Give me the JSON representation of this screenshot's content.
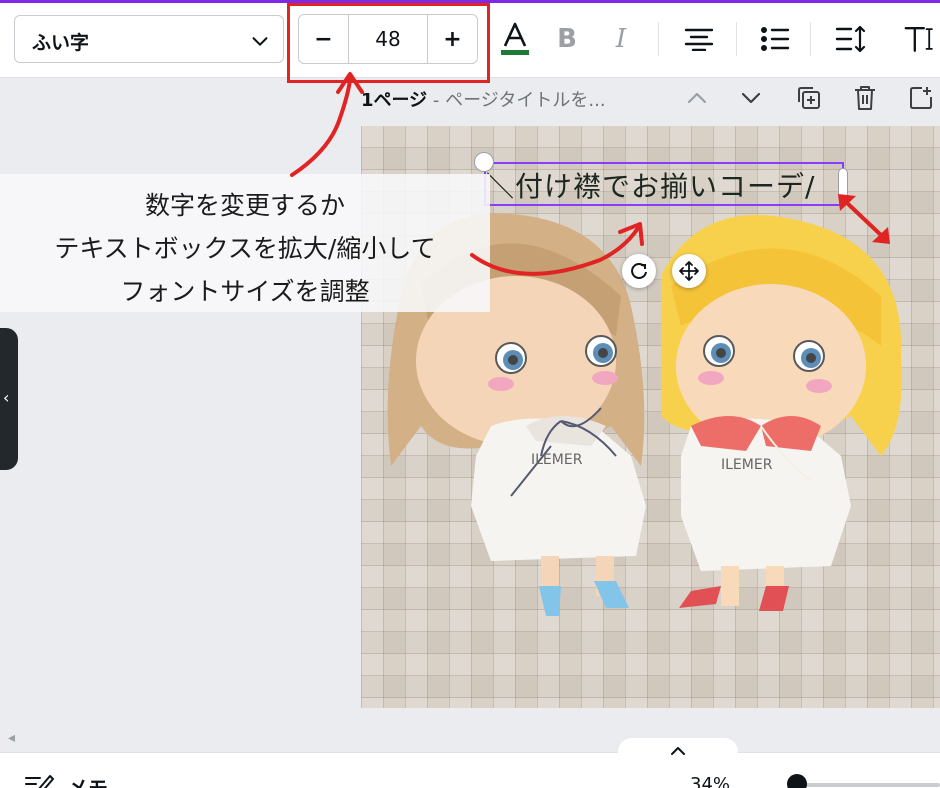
{
  "toolbar": {
    "font_name": "ふい字",
    "font_size": "48",
    "minus_label": "−",
    "plus_label": "+",
    "accent_underline_color": "#1f7a3a",
    "highlight_color": "#e02424"
  },
  "page_header": {
    "page_number": "1ページ",
    "separator": " - ",
    "title_placeholder": "ページタイトルを..."
  },
  "canvas": {
    "text_content": "＼付け襟でお揃いコーデ/",
    "selection_color": "#8b3dff",
    "doll_left_shirt": "ILEMER",
    "doll_right_shirt": "ILEMER"
  },
  "annotation": {
    "line1": "数字を変更するか",
    "line2": "テキストボックスを拡大/縮小して",
    "line3": "フォントサイズを調整",
    "arrow_color": "#e02424"
  },
  "bottom": {
    "memo_label": "メモ",
    "zoom_level": "34%"
  }
}
